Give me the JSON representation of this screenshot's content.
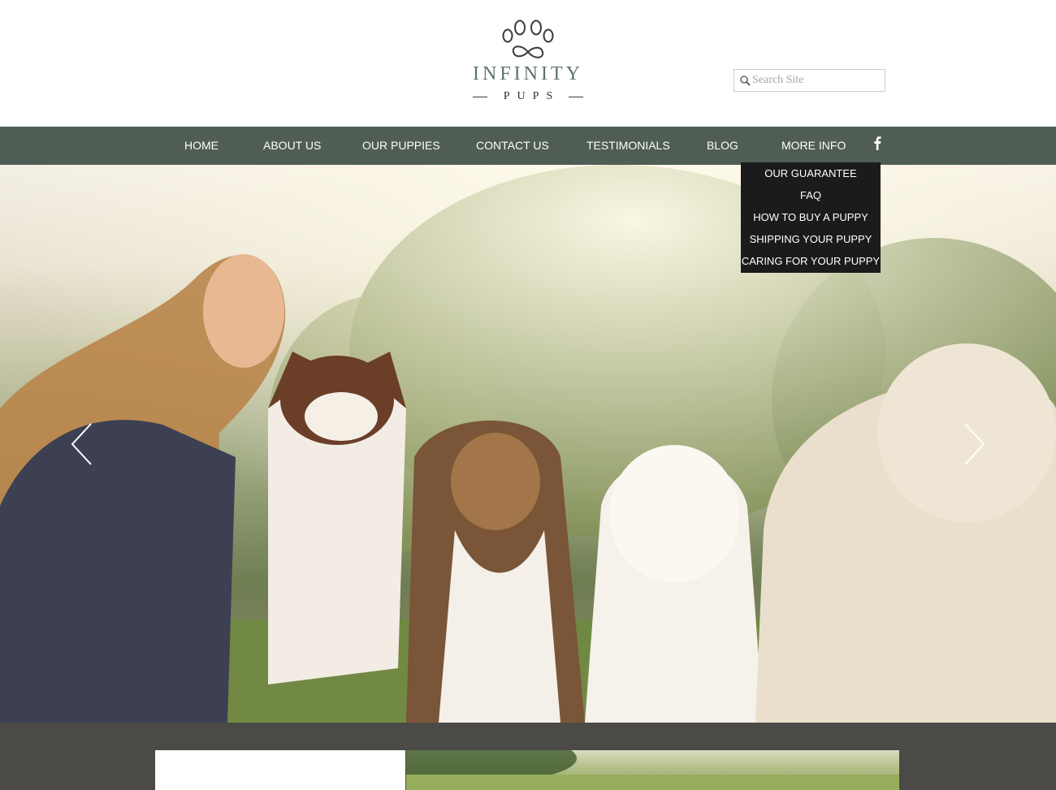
{
  "brand": {
    "name_line1": "INFINITY",
    "name_line2": "PUPS",
    "accent_color": "#5d7468"
  },
  "search": {
    "placeholder": "Search Site",
    "icon": "search-icon"
  },
  "nav": {
    "background": "#4f5d54",
    "items": [
      {
        "label": "HOME"
      },
      {
        "label": "ABOUT US"
      },
      {
        "label": "OUR PUPPIES"
      },
      {
        "label": "CONTACT US"
      },
      {
        "label": "TESTIMONIALS"
      },
      {
        "label": "BLOG"
      },
      {
        "label": "MORE INFO"
      }
    ],
    "social_icon": "facebook-icon"
  },
  "more_info_menu": {
    "items": [
      {
        "label": "OUR GUARANTEE"
      },
      {
        "label": "FAQ"
      },
      {
        "label": "HOW TO BUY A PUPPY"
      },
      {
        "label": "SHIPPING YOUR PUPPY"
      },
      {
        "label": "CARING FOR YOUR PUPPY"
      }
    ]
  },
  "hero": {
    "prev_icon": "chevron-left-icon",
    "next_icon": "chevron-right-icon"
  }
}
